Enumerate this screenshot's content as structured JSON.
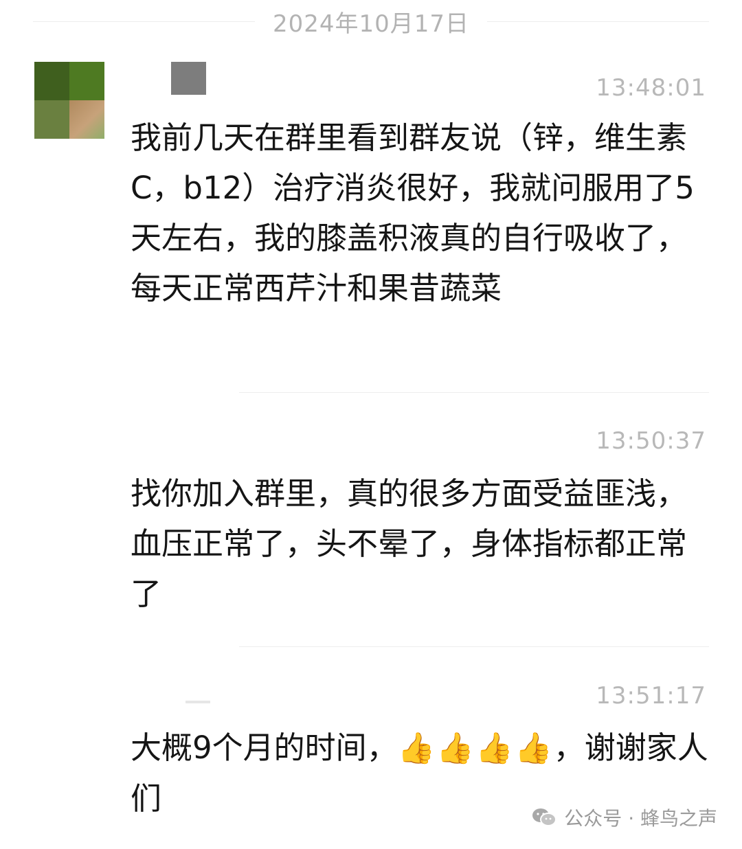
{
  "date_separator": "2024年10月17日",
  "messages": [
    {
      "time": "13:48:01",
      "text": "我前几天在群里看到群友说（锌，维生素C，b12）治疗消炎很好，我就问服用了5天左右，我的膝盖积液真的自行吸收了，\n每天正常西芹汁和果昔蔬菜"
    },
    {
      "time": "13:50:37",
      "text": "找你加入群里，真的很多方面受益匪浅，血压正常了，头不晕了，身体指标都正常了"
    },
    {
      "time": "13:51:17",
      "text_before": "大概9个月的时间，",
      "emoji": "👍👍👍👍",
      "text_after": "，谢谢家人们"
    }
  ],
  "watermark": {
    "text": "公众号 · 蜂鸟之声",
    "icon": "wechat-icon"
  }
}
